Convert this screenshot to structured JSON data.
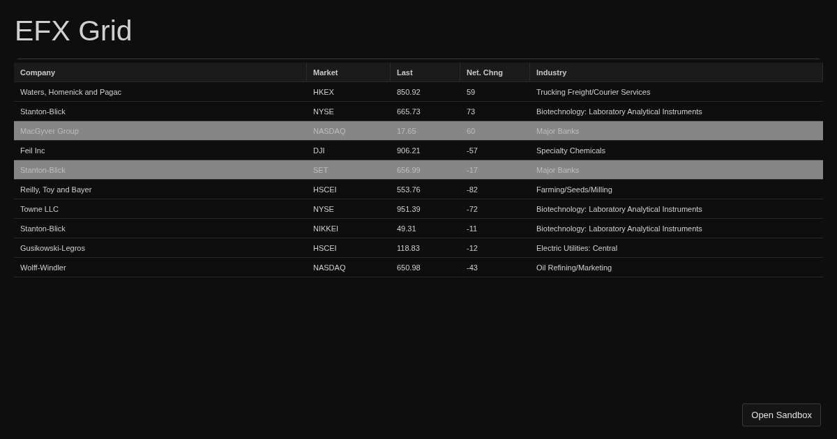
{
  "title": "EFX Grid",
  "table": {
    "columns": [
      "Company",
      "Market",
      "Last",
      "Net. Chng",
      "Industry"
    ],
    "rows": [
      {
        "cells": [
          "Waters, Homenick and Pagac",
          "HKEX",
          "850.92",
          "59",
          "Trucking Freight/Courier Services"
        ],
        "selected": false
      },
      {
        "cells": [
          "Stanton-Blick",
          "NYSE",
          "665.73",
          "73",
          "Biotechnology: Laboratory Analytical Instruments"
        ],
        "selected": false
      },
      {
        "cells": [
          "MacGyver Group",
          "NASDAQ",
          "17.65",
          "60",
          "Major Banks"
        ],
        "selected": true
      },
      {
        "cells": [
          "Feil Inc",
          "DJI",
          "906.21",
          "-57",
          "Specialty Chemicals"
        ],
        "selected": false
      },
      {
        "cells": [
          "Stanton-Blick",
          "SET",
          "656.99",
          "-17",
          "Major Banks"
        ],
        "selected": true
      },
      {
        "cells": [
          "Reilly, Toy and Bayer",
          "HSCEI",
          "553.76",
          "-82",
          "Farming/Seeds/Milling"
        ],
        "selected": false
      },
      {
        "cells": [
          "Towne LLC",
          "NYSE",
          "951.39",
          "-72",
          "Biotechnology: Laboratory Analytical Instruments"
        ],
        "selected": false
      },
      {
        "cells": [
          "Stanton-Blick",
          "NIKKEI",
          "49.31",
          "-11",
          "Biotechnology: Laboratory Analytical Instruments"
        ],
        "selected": false
      },
      {
        "cells": [
          "Gusikowski-Legros",
          "HSCEI",
          "118.83",
          "-12",
          "Electric Utilities: Central"
        ],
        "selected": false
      },
      {
        "cells": [
          "Wolff-Windler",
          "NASDAQ",
          "650.98",
          "-43",
          "Oil Refining/Marketing"
        ],
        "selected": false
      }
    ]
  },
  "button": "Open Sandbox"
}
